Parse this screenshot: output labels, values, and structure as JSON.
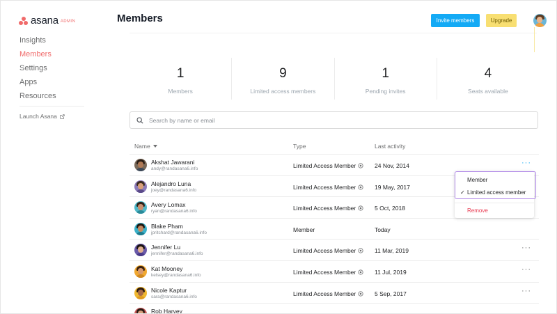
{
  "app": {
    "logo_text": "asana",
    "logo_badge": "ADMIN",
    "brand_color": "#f06a6a",
    "accent_color": "#14aaf5"
  },
  "sidebar": {
    "items": [
      {
        "label": "Insights",
        "active": false
      },
      {
        "label": "Members",
        "active": true
      },
      {
        "label": "Settings",
        "active": false
      },
      {
        "label": "Apps",
        "active": false
      },
      {
        "label": "Resources",
        "active": false
      }
    ],
    "launch_label": "Launch Asana",
    "launch_icon": "external-link-icon"
  },
  "header": {
    "title": "Members",
    "invite_label": "Invite members",
    "upgrade_label": "Upgrade"
  },
  "stats": [
    {
      "value": "1",
      "label": "Members"
    },
    {
      "value": "9",
      "label": "Limited access members"
    },
    {
      "value": "1",
      "label": "Pending invites"
    },
    {
      "value": "4",
      "label": "Seats available"
    }
  ],
  "search": {
    "placeholder": "Search by name or email",
    "value": "",
    "icon": "search-icon"
  },
  "table": {
    "columns": {
      "name": "Name",
      "type": "Type",
      "activity": "Last activity"
    },
    "rows": [
      {
        "name": "Akshat Jawarani",
        "email": "andy@randasana6.info",
        "type": "Limited Access Member",
        "activity": "24 Nov, 2014",
        "more": "···",
        "info_icon": true,
        "more_active": true
      },
      {
        "name": "Alejandro Luna",
        "email": "joey@randasana6.info",
        "type": "Limited Access Member",
        "activity": "19 May, 2017",
        "more": "",
        "info_icon": true
      },
      {
        "name": "Avery Lomax",
        "email": "ryan@randasana6.info",
        "type": "Limited Access Member",
        "activity": "5 Oct, 2018",
        "more": "",
        "info_icon": true
      },
      {
        "name": "Blake Pham",
        "email": "jpritchard@randasana6.info",
        "type": "Member",
        "activity": "Today",
        "more": "",
        "info_icon": false
      },
      {
        "name": "Jennifer Lu",
        "email": "jennifer@randasana6.info",
        "type": "Limited Access Member",
        "activity": "11 Mar, 2019",
        "more": "···",
        "info_icon": true
      },
      {
        "name": "Kat Mooney",
        "email": "kelsey@randasana6.info",
        "type": "Limited Access Member",
        "activity": "11 Jul, 2019",
        "more": "···",
        "info_icon": true
      },
      {
        "name": "Nicole Kaptur",
        "email": "sara@randasana6.info",
        "type": "Limited Access Member",
        "activity": "5 Sep, 2017",
        "more": "···",
        "info_icon": true
      },
      {
        "name": "Rob Harvey",
        "email": "",
        "type": "",
        "activity": "",
        "more": "",
        "info_icon": false
      }
    ]
  },
  "dropdown": {
    "options": [
      {
        "label": "Member",
        "checked": false
      },
      {
        "label": "Limited access member",
        "checked": true
      }
    ],
    "check_mark": "✓",
    "remove_label": "Remove",
    "remove_color": "#e8384f"
  }
}
